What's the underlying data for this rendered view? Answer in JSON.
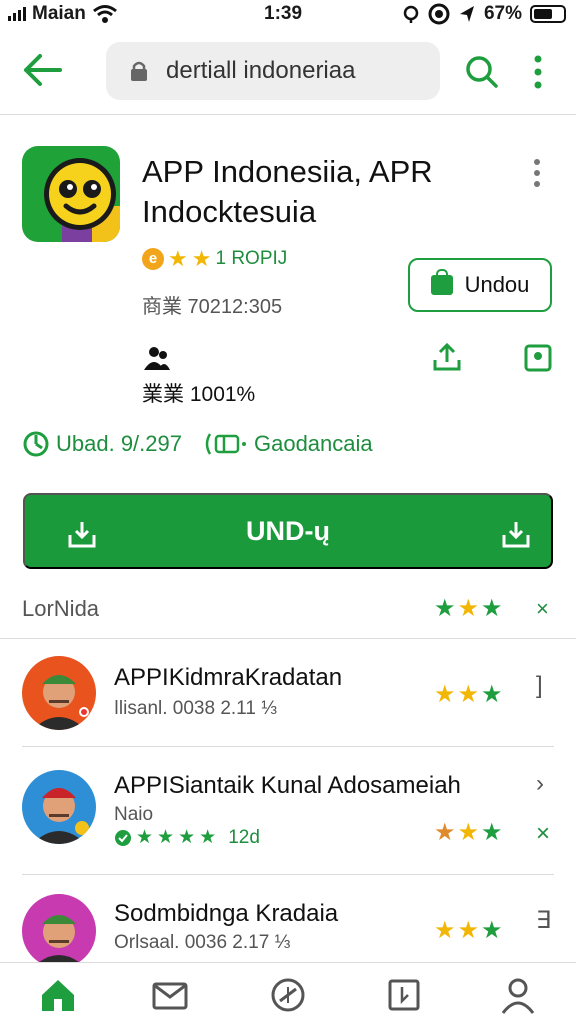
{
  "status_bar": {
    "carrier": "Maian",
    "time": "1:39",
    "battery": "67%"
  },
  "app_bar": {
    "search_value": "dertiall indoneriaa"
  },
  "app": {
    "title": "APP Indonesiia, APR Indocktesuia",
    "rating_badge": "e",
    "rating_text": "1 ROPIJ",
    "size_line": "商業 70212:305",
    "percent_line": "業業 1001%",
    "open_label": "Undou"
  },
  "info": {
    "updated": "Ubad. 9/.297",
    "category": "Gaodancaia"
  },
  "install": {
    "label": "UND-ų"
  },
  "section": {
    "heading": "LorNida",
    "close": "×"
  },
  "list": [
    {
      "name": "APPIKidmraKradatan",
      "meta": "ǀlisanl. 0038 2.11 ⅓",
      "action": "]"
    },
    {
      "name": "APPISiantaik Kunal Adosameiah",
      "meta": "Naio",
      "rating_text": "12d",
      "action": "›",
      "action2": "×"
    },
    {
      "name": "Sodmbidnga Kradaia",
      "meta": "Orlsaal. 0036 2.17 ⅓",
      "action": "∃"
    }
  ],
  "colors": {
    "primary_green": "#1a9a3a",
    "star_yellow": "#f2b705",
    "star_green": "#1e9e3e",
    "star_orange": "#e08a2e"
  }
}
